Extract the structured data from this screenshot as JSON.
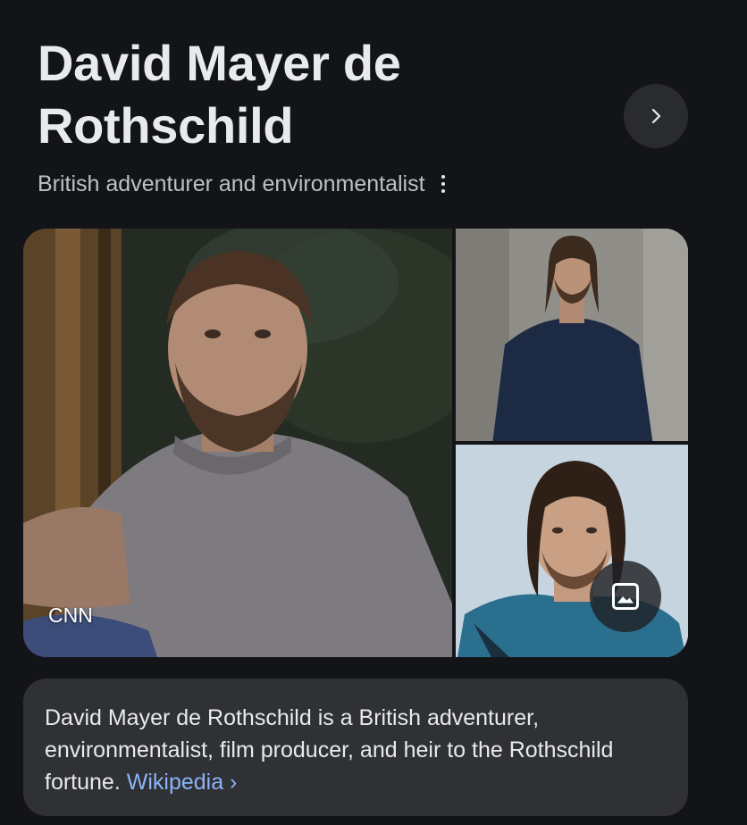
{
  "entity": {
    "title": "David Mayer de Rothschild",
    "subtitle": "British adventurer and environmentalist"
  },
  "icons": {
    "next": "chevron-right-icon",
    "more": "more-vert-icon",
    "images": "image-icon"
  },
  "gallery": {
    "main_source": "CNN"
  },
  "description": {
    "text": "David Mayer de Rothschild is a British adventurer, environmentalist, film producer, and heir to the Rothschild fortune.",
    "source_link": "Wikipedia ›"
  },
  "colors": {
    "background": "#131418",
    "card": "#303134",
    "link": "#8ab4f8",
    "button": "#2a2b2f"
  }
}
